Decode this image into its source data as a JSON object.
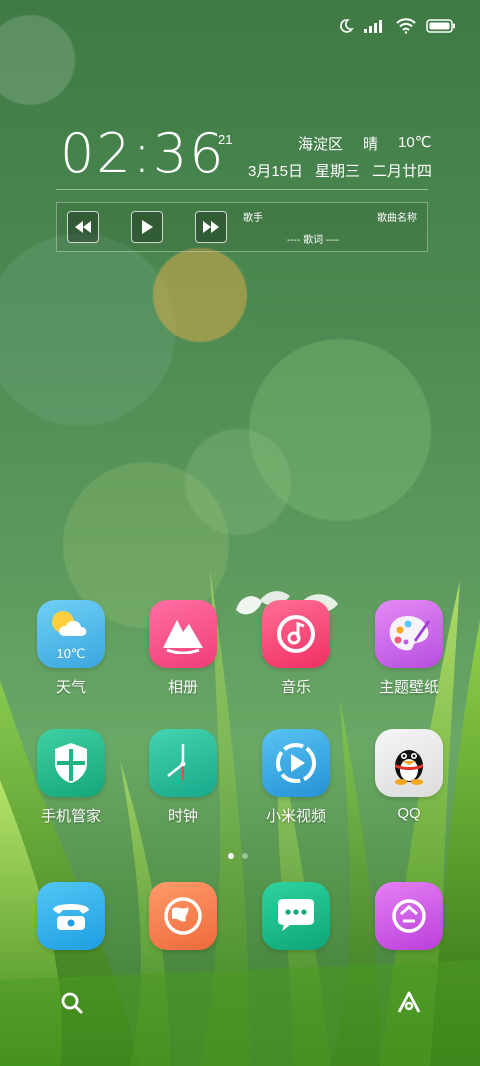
{
  "status_bar": {
    "icons": [
      "moon-icon",
      "signal-icon",
      "wifi-icon",
      "battery-icon"
    ]
  },
  "clock_widget": {
    "time": "02:36",
    "seconds": "21",
    "location": "海淀区",
    "weather": "晴",
    "temperature": "10℃",
    "date": "3月15日",
    "weekday": "星期三",
    "lunar_date": "二月廿四"
  },
  "music_widget": {
    "artist": "歌手",
    "song_title": "歌曲名称",
    "lyrics": "---- 歌词 ----"
  },
  "apps": [
    {
      "label": "天气",
      "badge": "10℃",
      "icon": "weather-icon",
      "color": "#4cb6ea"
    },
    {
      "label": "相册",
      "icon": "gallery-icon",
      "color": "#f2467f"
    },
    {
      "label": "音乐",
      "icon": "music-icon",
      "color": "#f3356e"
    },
    {
      "label": "主题壁纸",
      "icon": "themes-icon",
      "color": "#c35ae3"
    },
    {
      "label": "手机管家",
      "icon": "security-shield-icon",
      "color": "#23b18a"
    },
    {
      "label": "时钟",
      "icon": "clock-icon",
      "color": "#24b79a"
    },
    {
      "label": "小米视频",
      "icon": "video-play-icon",
      "color": "#2ea6dd"
    },
    {
      "label": "QQ",
      "icon": "qq-penguin-icon",
      "color": "#e8e8e8"
    }
  ],
  "dock": [
    {
      "icon": "phone-icon",
      "color": "#2db0ea"
    },
    {
      "icon": "browser-globe-icon",
      "color": "#f47d50"
    },
    {
      "icon": "messages-icon",
      "color": "#12b585"
    },
    {
      "icon": "wallet-icon",
      "color": "#c64ae0"
    }
  ],
  "page_indicator": {
    "count": 2,
    "active": 0
  }
}
